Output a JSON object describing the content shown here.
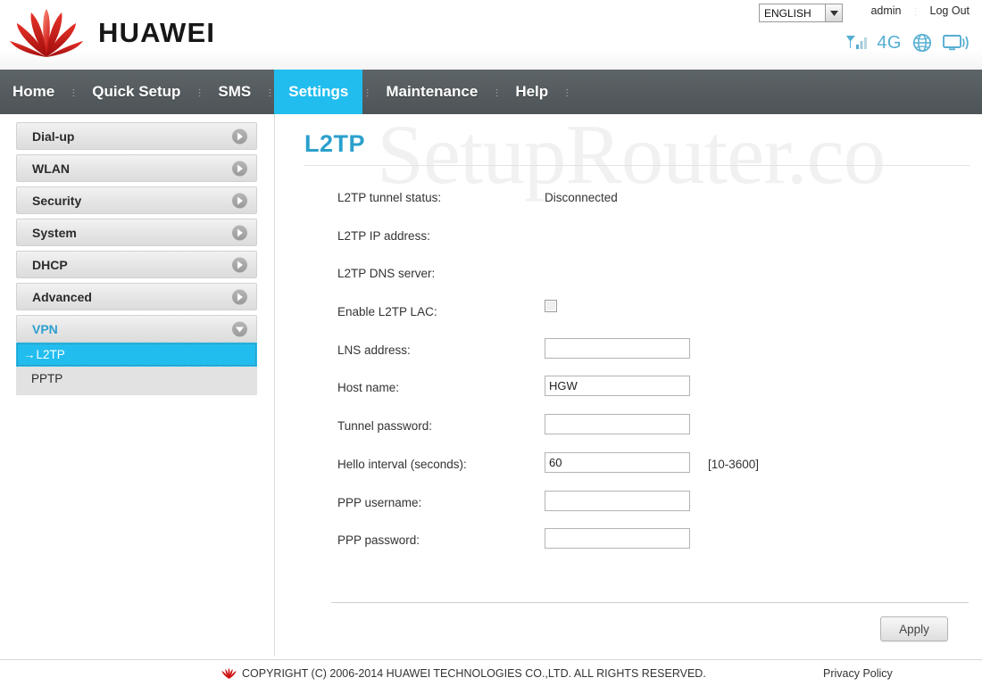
{
  "header": {
    "brand": "HUAWEI",
    "brand_logo_icon": "huawei-flower-logo",
    "language": {
      "selected": "ENGLISH",
      "options": [
        "ENGLISH"
      ],
      "dropdown_icon": "chevron-down-icon"
    },
    "user": "admin",
    "logout": "Log Out",
    "status_icons": [
      {
        "name": "signal-bars-icon",
        "label": ""
      },
      {
        "name": "network-type-4g-label",
        "label": "4G"
      },
      {
        "name": "globe-internet-icon",
        "label": ""
      },
      {
        "name": "wifi-broadcast-monitor-icon",
        "label": ""
      }
    ]
  },
  "nav": {
    "items": [
      {
        "label": "Home",
        "active": false
      },
      {
        "label": "Quick Setup",
        "active": false
      },
      {
        "label": "SMS",
        "active": false
      },
      {
        "label": "Settings",
        "active": true
      },
      {
        "label": "Maintenance",
        "active": false
      },
      {
        "label": "Help",
        "active": false
      }
    ],
    "separator": "⋮"
  },
  "sidebar": {
    "items": [
      {
        "label": "Dial-up",
        "state": "collapsed",
        "icon": "chevron-right-circle-icon"
      },
      {
        "label": "WLAN",
        "state": "collapsed",
        "icon": "chevron-right-circle-icon"
      },
      {
        "label": "Security",
        "state": "collapsed",
        "icon": "chevron-right-circle-icon"
      },
      {
        "label": "System",
        "state": "collapsed",
        "icon": "chevron-right-circle-icon"
      },
      {
        "label": "DHCP",
        "state": "collapsed",
        "icon": "chevron-right-circle-icon"
      },
      {
        "label": "Advanced",
        "state": "collapsed",
        "icon": "chevron-right-circle-icon"
      },
      {
        "label": "VPN",
        "state": "expanded",
        "icon": "chevron-down-circle-icon"
      }
    ],
    "vpn_submenu": [
      {
        "label": "L2TP",
        "prefix": "→",
        "selected": true
      },
      {
        "label": "PPTP",
        "prefix": "",
        "selected": false
      }
    ]
  },
  "content": {
    "watermark": "SetupRouter.co",
    "title": "L2TP",
    "fields": [
      {
        "label": "L2TP tunnel status:",
        "type": "text",
        "value": "Disconnected",
        "hint": ""
      },
      {
        "label": "L2TP IP address:",
        "type": "text",
        "value": "",
        "hint": ""
      },
      {
        "label": "L2TP DNS server:",
        "type": "text",
        "value": "",
        "hint": ""
      },
      {
        "label": "Enable L2TP LAC:",
        "type": "checkbox",
        "checked": false,
        "hint": ""
      },
      {
        "label": "LNS address:",
        "type": "input",
        "value": "",
        "placeholder": "",
        "hint": ""
      },
      {
        "label": "Host name:",
        "type": "input",
        "value": "HGW",
        "placeholder": "",
        "hint": ""
      },
      {
        "label": "Tunnel password:",
        "type": "password",
        "value": "",
        "placeholder": "",
        "hint": ""
      },
      {
        "label": "Hello interval (seconds):",
        "type": "input",
        "value": "60",
        "placeholder": "",
        "hint": "[10-3600]"
      },
      {
        "label": "PPP username:",
        "type": "input",
        "value": "",
        "placeholder": "",
        "hint": ""
      },
      {
        "label": "PPP password:",
        "type": "password",
        "value": "",
        "placeholder": "",
        "hint": ""
      }
    ],
    "apply_label": "Apply"
  },
  "footer": {
    "copyright": "COPYRIGHT (C) 2006-2014 HUAWEI TECHNOLOGIES CO.,LTD. ALL RIGHTS RESERVED.",
    "copyright_icon": "huawei-flower-logo-small",
    "privacy": "Privacy Policy"
  },
  "colors": {
    "accent_cyan": "#22bdef",
    "title_blue": "#2ba0cd",
    "nav_bg": "#555c5f",
    "brand_red": "#cf0a0a",
    "icon_blue": "#55aed2"
  }
}
